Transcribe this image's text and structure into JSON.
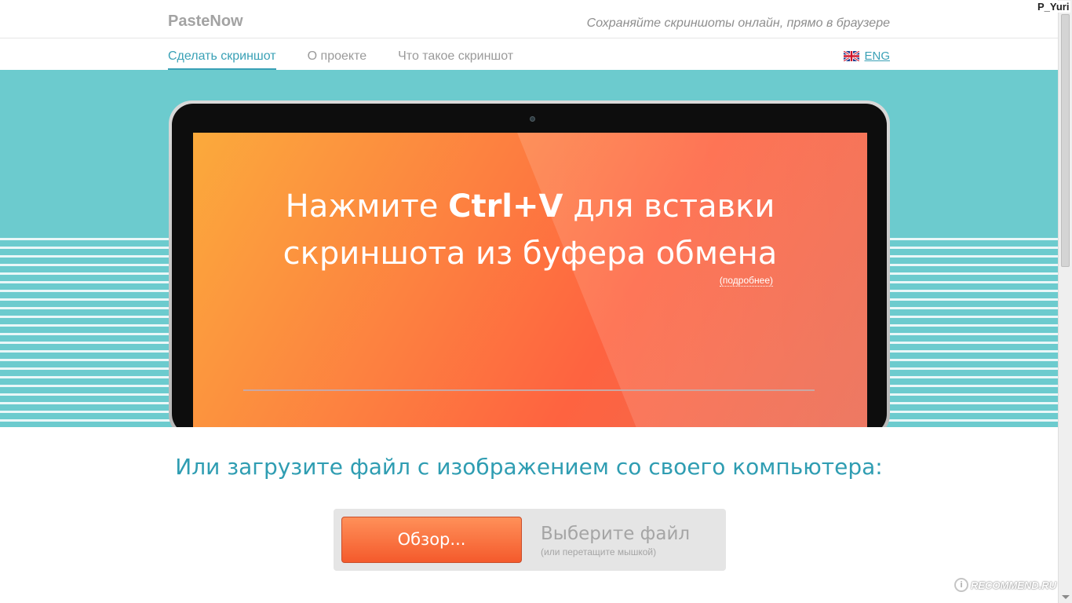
{
  "header": {
    "brand": "PasteNow",
    "tagline": "Сохраняйте скриншоты онлайн, прямо в браузере"
  },
  "nav": {
    "items": [
      {
        "label": "Сделать скриншот",
        "active": true
      },
      {
        "label": "О проекте",
        "active": false
      },
      {
        "label": "Что такое скриншот",
        "active": false
      }
    ],
    "language": {
      "label": "ENG",
      "icon": "uk-flag-icon"
    }
  },
  "hero": {
    "line1_before": "Нажмите ",
    "line1_shortcut": "Ctrl+V",
    "line1_after": " для вставки",
    "line2": "скриншота из буфера обмена",
    "more_link": "(подробнее)"
  },
  "upload": {
    "title": "Или загрузите файл с изображением со своего компьютера:",
    "browse_button": "Обзор...",
    "choose_file": "Выберите файл",
    "choose_hint": "(или перетащите мышкой)"
  },
  "system": {
    "user": "P_Yuri"
  },
  "watermark": {
    "badge": "i",
    "text": "RECOMMEND.RU"
  },
  "colors": {
    "accent": "#3aa1b6",
    "hero_background": "#6ccbce",
    "button": "#f45a2c"
  }
}
